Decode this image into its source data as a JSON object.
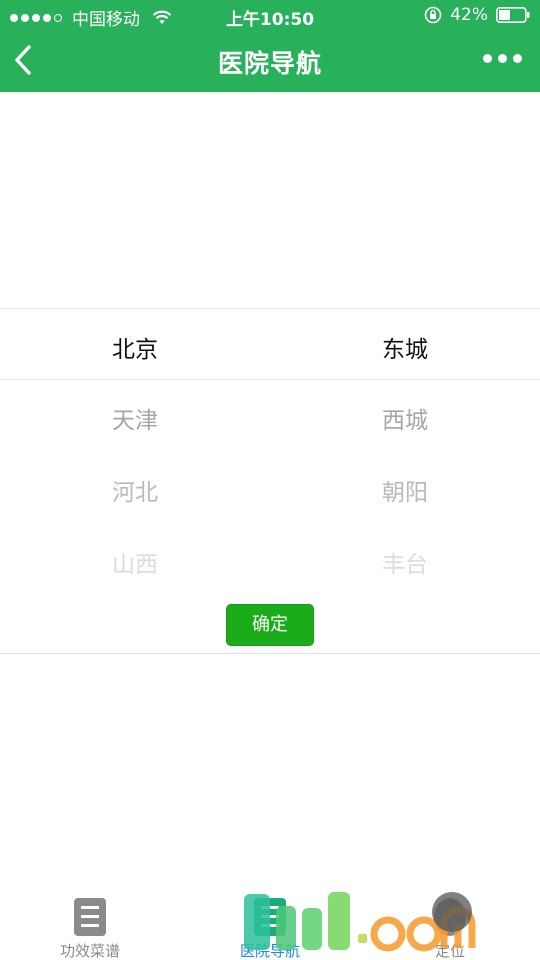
{
  "status_bar": {
    "carrier": "中国移动",
    "time": "上午10:50",
    "battery": "42%"
  },
  "nav": {
    "title": "医院导航"
  },
  "picker": {
    "provinces": [
      "北京",
      "天津",
      "河北",
      "山西"
    ],
    "districts": [
      "东城",
      "西城",
      "朝阳",
      "丰台"
    ],
    "confirm_label": "确定"
  },
  "tabs": [
    {
      "label": "功效菜谱",
      "active": false
    },
    {
      "label": "医院导航",
      "active": true
    },
    {
      "label": "定位",
      "active": false
    }
  ],
  "colors": {
    "brand_green": "#29b05a",
    "button_green": "#1aac19",
    "active_tab_text": "#1a8ce0"
  }
}
